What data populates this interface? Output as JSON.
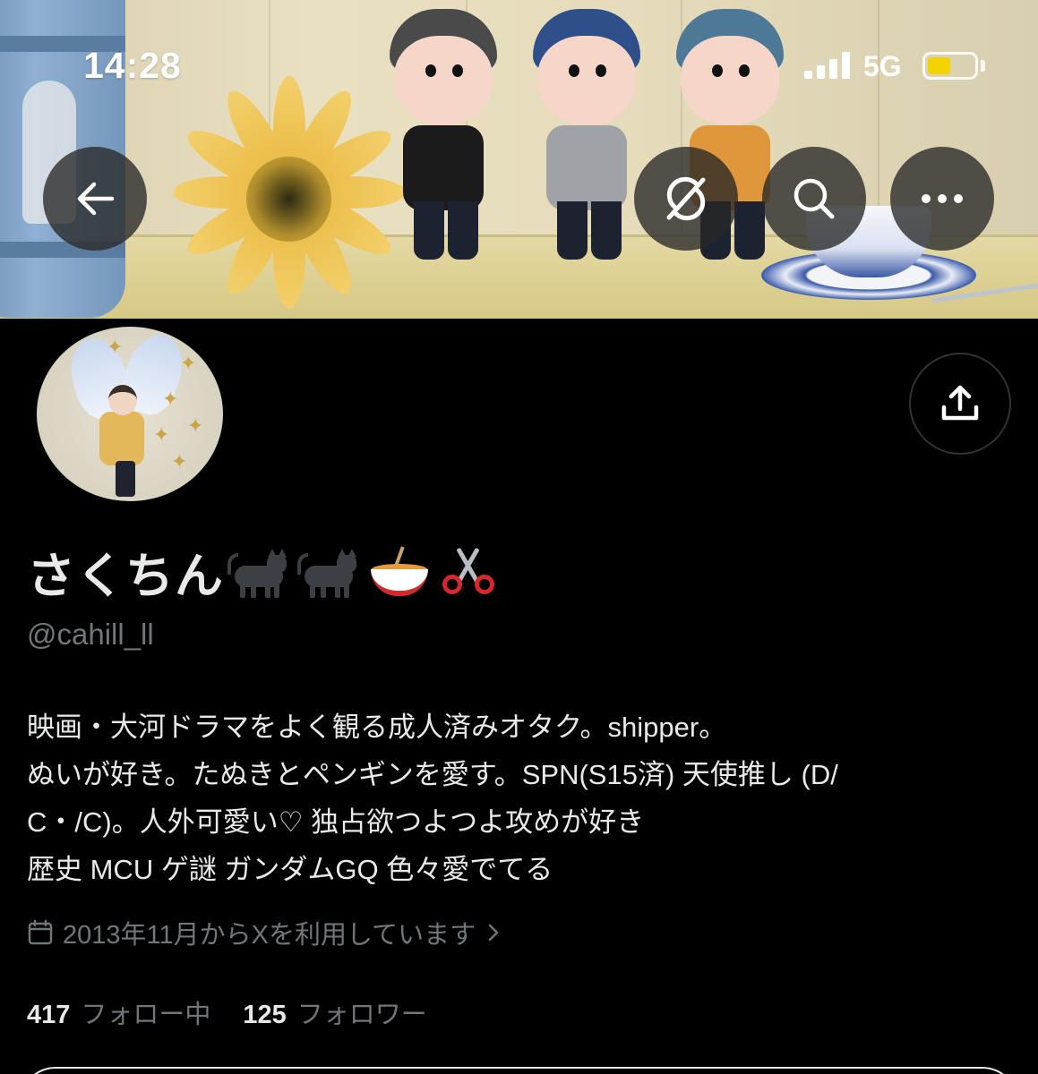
{
  "status_bar": {
    "time": "14:28",
    "network": "5G",
    "battery_level": 0.5,
    "battery_color": "#f5d300"
  },
  "header": {
    "back_icon": "back-arrow-icon",
    "grok_icon": "grok-slash-icon",
    "search_icon": "search-icon",
    "more_icon": "more-horizontal-icon",
    "share_icon": "share-upload-icon"
  },
  "profile": {
    "display_name": "さくちん",
    "display_name_emojis": [
      "black-cat-icon",
      "black-cat-icon",
      "noodle-bowl-icon",
      "scissors-icon"
    ],
    "handle": "@cahill_ll",
    "bio_lines": [
      "映画・大河ドラマをよく観る成人済みオタク。shipper。",
      "ぬいが好き。たぬきとペンギンを愛す。SPN(S15済) 天使推し (D/",
      "C・/C)。人外可愛い♡ 独占欲つよつよ攻めが好き",
      "歴史 MCU ゲ謎 ガンダムGQ 色々愛でてる"
    ],
    "joined": "2013年11月からXを利用しています",
    "following_count": "417",
    "following_label": "フォロー中",
    "followers_count": "125",
    "followers_label": "フォロワー"
  },
  "colors": {
    "background": "#000000",
    "primary_text": "#e7e9ea",
    "secondary_text": "#71767b",
    "border": "#2f3336"
  }
}
